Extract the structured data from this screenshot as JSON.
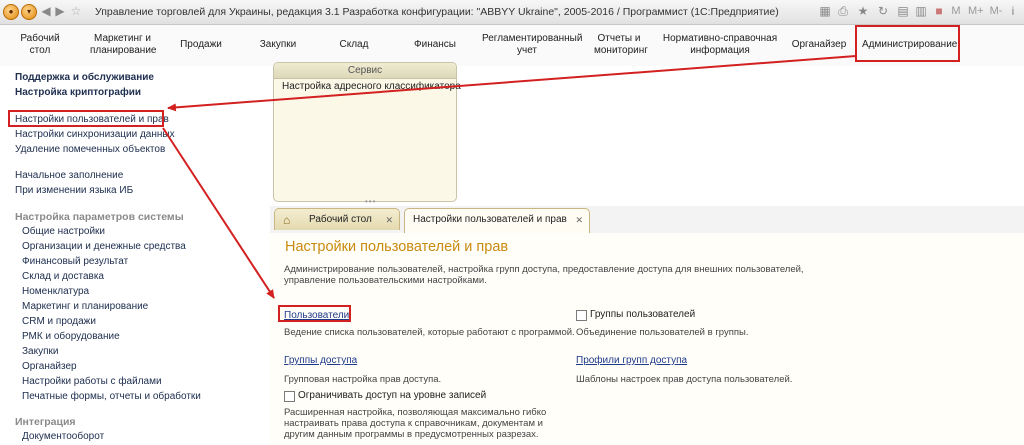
{
  "window": {
    "title": "Управление торговлей для Украины, редакция 3.1 Разработка конфигурации: \"ABBYY Ukraine\", 2005-2016 / Программист  (1С:Предприятие)",
    "right_labels": [
      "M",
      "M+",
      "M-"
    ]
  },
  "menu": {
    "items": [
      {
        "label": "Рабочий\nстол"
      },
      {
        "label": "Маркетинг и\nпланирование"
      },
      {
        "label": "Продажи"
      },
      {
        "label": "Закупки"
      },
      {
        "label": "Склад"
      },
      {
        "label": "Финансы"
      },
      {
        "label": "Регламентированный\nучет"
      },
      {
        "label": "Отчеты и\nмониторинг"
      },
      {
        "label": "Нормативно-справочная\nинформация"
      },
      {
        "label": "Органайзер"
      },
      {
        "label": "Администрирование"
      }
    ],
    "highlighted": "Администрирование"
  },
  "sidebar": {
    "top_bold": [
      "Поддержка и обслуживание",
      "Настройка криптографии"
    ],
    "links_a": [
      "Настройки пользователей и прав",
      "Настройки синхронизации данных",
      "Удаление помеченных объектов"
    ],
    "links_b": [
      "Начальное заполнение",
      "При изменении языка ИБ"
    ],
    "section1": "Настройка параметров системы",
    "section1_items": [
      "Общие настройки",
      "Организации и денежные средства",
      "Финансовый результат",
      "Склад и доставка",
      "Номенклатура",
      "Маркетинг и планирование",
      "CRM и продажи",
      "РМК и оборудование",
      "Закупки",
      "Органайзер",
      "Настройки работы с файлами",
      "Печатные формы, отчеты и обработки"
    ],
    "section2": "Интеграция",
    "section2_items": [
      "Документооборот"
    ]
  },
  "service": {
    "header": "Сервис",
    "link": "Настройка адресного классификатора"
  },
  "tabs": [
    {
      "label": "Рабочий стол",
      "active": false
    },
    {
      "label": "Настройки пользователей и прав",
      "active": true
    }
  ],
  "page": {
    "title": "Настройки пользователей и прав",
    "description": "Администрирование пользователей, настройка групп доступа, предоставление доступа для внешних пользователей, управление пользовательскими настройками.",
    "users_link": "Пользователи",
    "users_desc": "Ведение списка пользователей, которые работают с программой.",
    "user_groups_label": "Группы пользователей",
    "user_groups_desc": "Объединение пользователей в группы.",
    "access_groups_link": "Группы доступа",
    "access_groups_desc": "Групповая настройка прав доступа.",
    "access_profiles_link": "Профили групп доступа",
    "access_profiles_desc": "Шаблоны настроек прав доступа пользователей.",
    "restrict_label": "Ограничивать доступ на уровне записей",
    "restrict_desc": "Расширенная настройка, позволяющая максимально гибко настраивать права доступа к справочникам, документам и другим данным программы в предусмотренных разрезах."
  },
  "colors": {
    "title_accent": "#c98a10",
    "link": "#1f3a8a",
    "annotation_red": "#d32020"
  }
}
